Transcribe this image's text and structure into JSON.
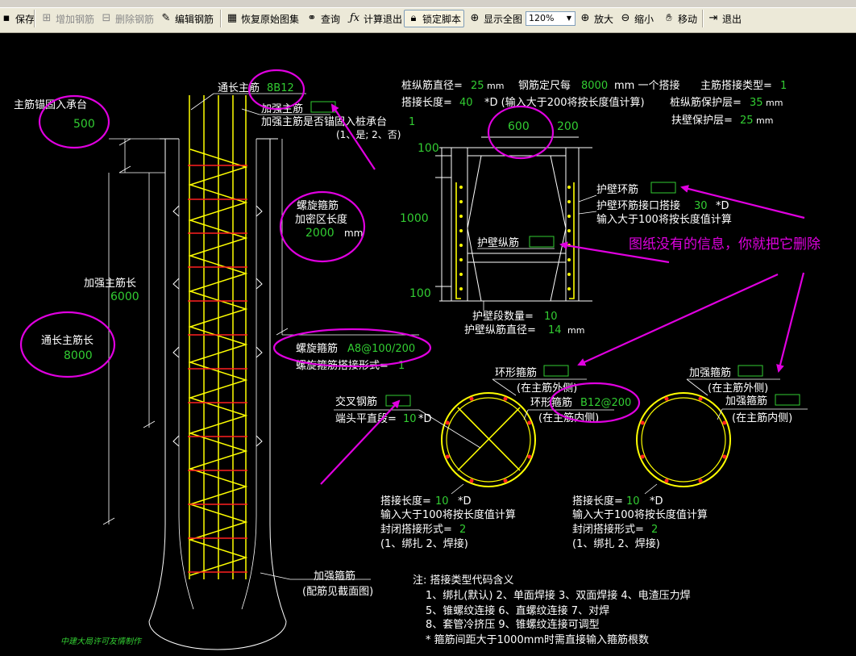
{
  "colors": {
    "background": "#000000",
    "label": "#ffffff",
    "value": "#32cd32",
    "highlight": "#e000e0",
    "rebar": "#ffff00",
    "stirrup": "#ff2020",
    "outline": "#ffffff"
  },
  "toolbar": {
    "items": [
      {
        "label": "保存",
        "icon": "save-icon",
        "state": "enabled"
      },
      {
        "label": "增加钢筋",
        "icon": "add-rebar-icon",
        "state": "disabled"
      },
      {
        "label": "删除钢筋",
        "icon": "delete-rebar-icon",
        "state": "disabled"
      },
      {
        "label": "编辑钢筋",
        "icon": "edit-rebar-icon",
        "state": "enabled"
      },
      {
        "label": "恢复原始图集",
        "icon": "restore-icon",
        "state": "enabled"
      },
      {
        "label": "查询",
        "icon": "binoculars-icon",
        "state": "enabled"
      },
      {
        "label": "计算退出",
        "icon": "formula-icon",
        "state": "enabled"
      },
      {
        "label": "锁定脚本",
        "icon": "lock-icon",
        "state": "pressed"
      },
      {
        "label": "显示全图",
        "icon": "zoom-extents-icon",
        "state": "enabled"
      },
      {
        "label": "放大",
        "icon": "zoom-in-icon",
        "state": "enabled"
      },
      {
        "label": "缩小",
        "icon": "zoom-out-icon",
        "state": "enabled"
      },
      {
        "label": "移动",
        "icon": "pan-hand-icon",
        "state": "enabled"
      },
      {
        "label": "退出",
        "icon": "exit-icon",
        "state": "enabled"
      }
    ],
    "zoom_value": "120%"
  },
  "drawing": {
    "elevation": {
      "main_anchor_label": "主筋锚固入承台",
      "main_anchor_value": "500",
      "through_rebar_label": "通长主筋",
      "through_rebar_value": "8B12",
      "reinforce_rebar_label": "加强主筋",
      "anchor_question": "加强主筋是否锚固入桩承台",
      "anchor_question_value": "1",
      "anchor_options": "(1、是; 2、否)",
      "spiral_dense_label_1": "螺旋箍筋",
      "spiral_dense_label_2": "加密区长度",
      "spiral_dense_value": "2000",
      "spiral_dense_unit": "mm",
      "reinforce_length_label": "加强主筋长",
      "reinforce_length_value": "6000",
      "through_length_label": "通长主筋长",
      "through_length_value": "8000",
      "spiral_stirrup_label": "螺旋箍筋",
      "spiral_stirrup_value": "A8@100/200",
      "spiral_lap_label": "螺旋箍筋搭接形式=",
      "spiral_lap_value": "1",
      "reinforce_stirrup_label": "加强箍筋",
      "reinforce_stirrup_note": "(配筋见截面图)",
      "credit": "中建大局许可友情制作"
    },
    "params": {
      "pile_long_dia_label": "桩纵筋直径=",
      "pile_long_dia_value": "25",
      "unit_mm": "mm",
      "fixed_length_label": "钢筋定尺每",
      "fixed_length_value": "8000",
      "fixed_length_suffix": "mm 一个搭接",
      "lap_type_label": "主筋搭接类型=",
      "lap_type_value": "1",
      "lap_len_label": "搭接长度=",
      "lap_len_value": "40",
      "lap_len_note": "*D (输入大于200将按长度值计算)",
      "cover_label": "桩纵筋保护层=",
      "cover_value": "35",
      "wall_cover_label": "扶壁保护层=",
      "wall_cover_value": "25"
    },
    "retaining_wall": {
      "dim_top_1": "600",
      "dim_top_2": "200",
      "dim_left_top": "100",
      "dim_left_mid": "1000",
      "dim_left_bottom": "100",
      "ring_rebar_label": "护壁环筋",
      "ring_lap_label": "护壁环筋接口搭接",
      "ring_lap_value": "30",
      "ring_lap_suffix": "*D",
      "ring_lap_note": "输入大于100将按长度值计算",
      "long_rebar_label": "护壁纵筋",
      "segment_count_label": "护壁段数量=",
      "segment_count_value": "10",
      "long_dia_label": "护壁纵筋直径=",
      "long_dia_value": "14",
      "long_dia_unit": "mm"
    },
    "annotation": {
      "text": "图纸没有的信息，你就把它删除"
    },
    "section_left": {
      "ring_stirrup_label": "环形箍筋",
      "ring_stirrup_pos": "(在主筋外侧)",
      "inner_ring_label": "环形箍筋",
      "inner_ring_value": "B12@200",
      "inner_ring_pos": "(在主筋内侧)",
      "cross_rebar_label": "交叉钢筋",
      "end_straight_label": "端头平直段=",
      "end_straight_value": "10",
      "end_straight_suffix": "*D",
      "lap_len_label": "搭接长度=",
      "lap_len_value": "10",
      "lap_len_suffix": "*D",
      "note": "输入大于100将按长度值计算",
      "close_lap_label": "封闭搭接形式=",
      "close_lap_value": "2",
      "close_options": "(1、绑扎  2、焊接)"
    },
    "section_right": {
      "stirrup_label": "加强箍筋",
      "stirrup_pos": "(在主筋外侧)",
      "inner_stirrup_label": "加强箍筋",
      "inner_stirrup_pos": "(在主筋内侧)",
      "lap_len_label": "搭接长度=",
      "lap_len_value": "10",
      "lap_len_suffix": "*D",
      "note": "输入大于100将按长度值计算",
      "close_lap_label": "封闭搭接形式=",
      "close_lap_value": "2",
      "close_options": "(1、绑扎  2、焊接)"
    },
    "notes": {
      "title": "注: 搭接类型代码含义",
      "line1": "1、绑扎(默认)    2、单面焊接    3、双面焊接    4、电渣压力焊",
      "line2": "5、锥螺纹连接    6、直螺纹连接    7、对焊",
      "line3": "8、套管冷挤压    9、锥螺纹连接可调型",
      "line4": "* 箍筋间距大于1000mm时需直接输入箍筋根数"
    }
  }
}
